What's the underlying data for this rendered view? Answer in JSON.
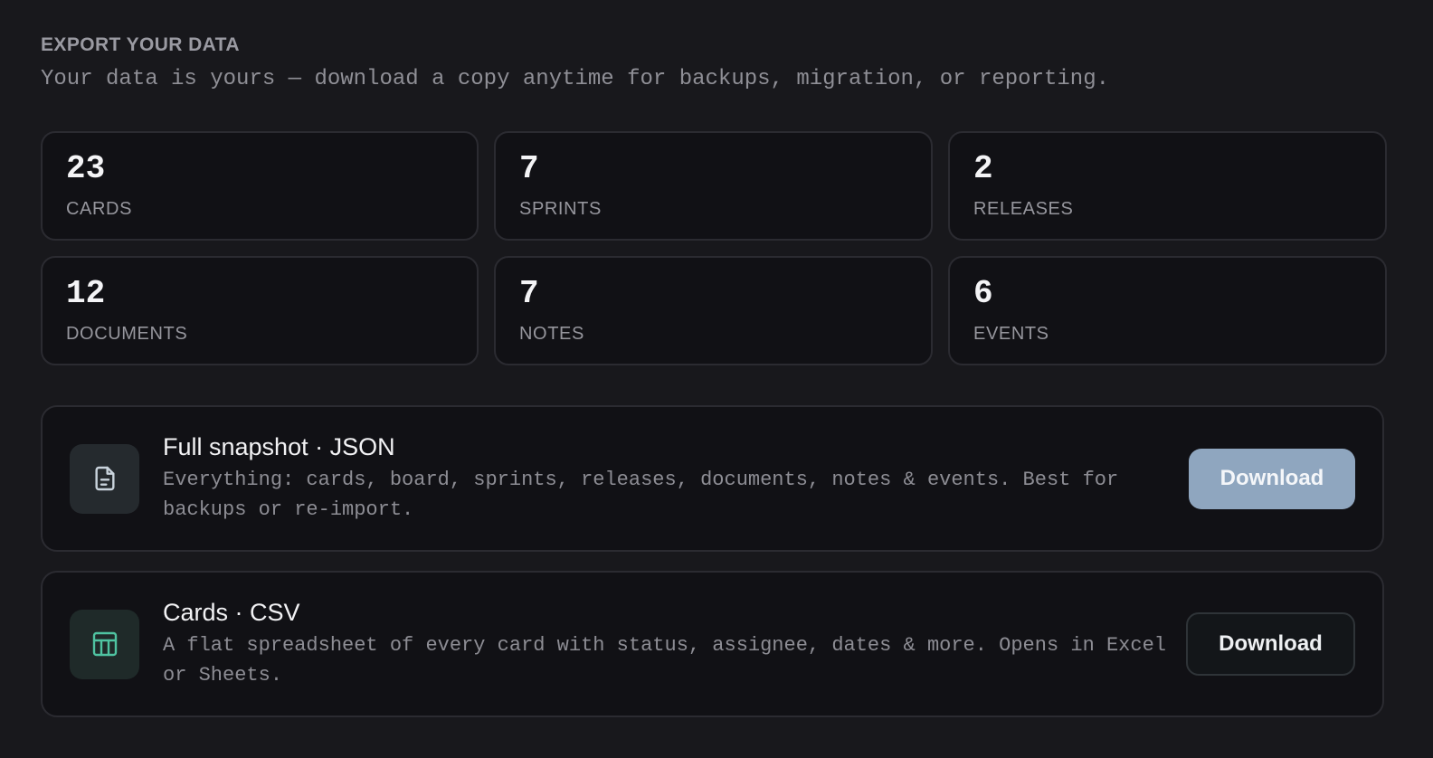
{
  "header": {
    "title": "EXPORT YOUR DATA",
    "description": "Your data is yours — download a copy anytime for backups, migration, or reporting."
  },
  "stats": [
    {
      "value": "23",
      "label": "CARDS"
    },
    {
      "value": "7",
      "label": "SPRINTS"
    },
    {
      "value": "2",
      "label": "RELEASES"
    },
    {
      "value": "12",
      "label": "DOCUMENTS"
    },
    {
      "value": "7",
      "label": "NOTES"
    },
    {
      "value": "6",
      "label": "EVENTS"
    }
  ],
  "exports": {
    "json": {
      "title": "Full snapshot · JSON",
      "description": "Everything: cards, board, sprints, releases, documents, notes & events. Best for backups or re-import.",
      "button_label": "Download",
      "icon": "file-text-icon",
      "icon_color": "#c9d3dc"
    },
    "csv": {
      "title": "Cards · CSV",
      "description": "A flat spreadsheet of every card with status, assignee, dates & more. Opens in Excel or Sheets.",
      "button_label": "Download",
      "icon": "table-icon",
      "icon_color": "#4fc3a1"
    }
  },
  "colors": {
    "background": "#18181c",
    "primary_button": "#8fa6bf"
  }
}
